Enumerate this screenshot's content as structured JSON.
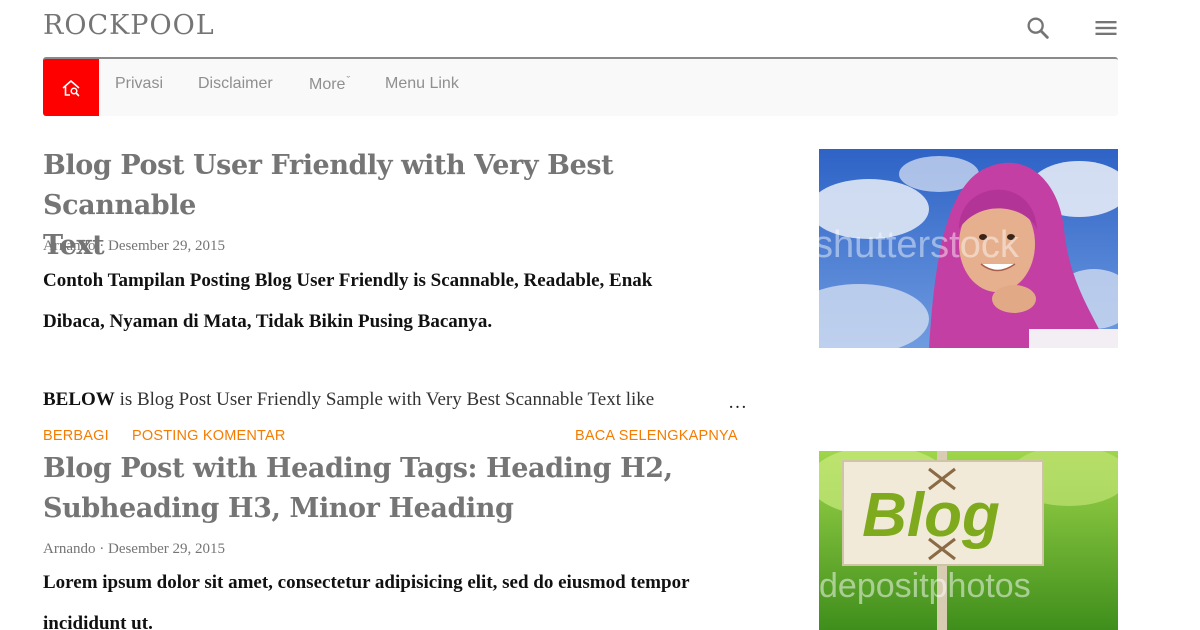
{
  "header": {
    "site_title": "ROCKPOOL",
    "icons": [
      "search-icon",
      "hamburger-menu-icon"
    ]
  },
  "nav": {
    "home_icon": "home-search-icon",
    "home_color": "#ff0000",
    "items": [
      {
        "label": "Privasi"
      },
      {
        "label": "Disclaimer"
      },
      {
        "label": "More",
        "caret": "ˇ"
      },
      {
        "label": "Menu Link"
      }
    ]
  },
  "posts": [
    {
      "title_line1": "Blog Post User Friendly with Very Best Scannable",
      "title_line2": "Text",
      "meta": "Arnando · Desember 29, 2015",
      "snippet_line1": "Contoh Tampilan Posting Blog User Friendly is Scannable, Readable, Enak",
      "snippet_line2": "Dibaca, Nyaman di Mata, Tidak Bikin Pusing Bacanya.",
      "body_bold": "BELOW",
      "body_rest": " is Blog Post User Friendly Sample with Very Best Scannable Text like",
      "ellipsis": "…",
      "thumbnail": {
        "watermark": "shutterstock"
      },
      "actions": {
        "share": "BERBAGI",
        "comment": "POSTING KOMENTAR",
        "read_more": "BACA SELENGKAPNYA"
      }
    },
    {
      "title_line1": "Blog Post with Heading Tags: Heading H2,",
      "title_line2": "Subheading H3, Minor Heading",
      "meta": "Arnando · Desember 29, 2015",
      "snippet_line1": "Lorem ipsum dolor sit amet, consectetur adipisicing elit, sed do eiusmod tempor",
      "snippet_line2": "incididunt ut.",
      "thumbnail": {
        "sign_text": "Blog",
        "watermark": "depositphotos"
      }
    }
  ],
  "colors": {
    "title": "#757575",
    "action": "#f57c00",
    "nav_text": "#8f8f8f"
  }
}
